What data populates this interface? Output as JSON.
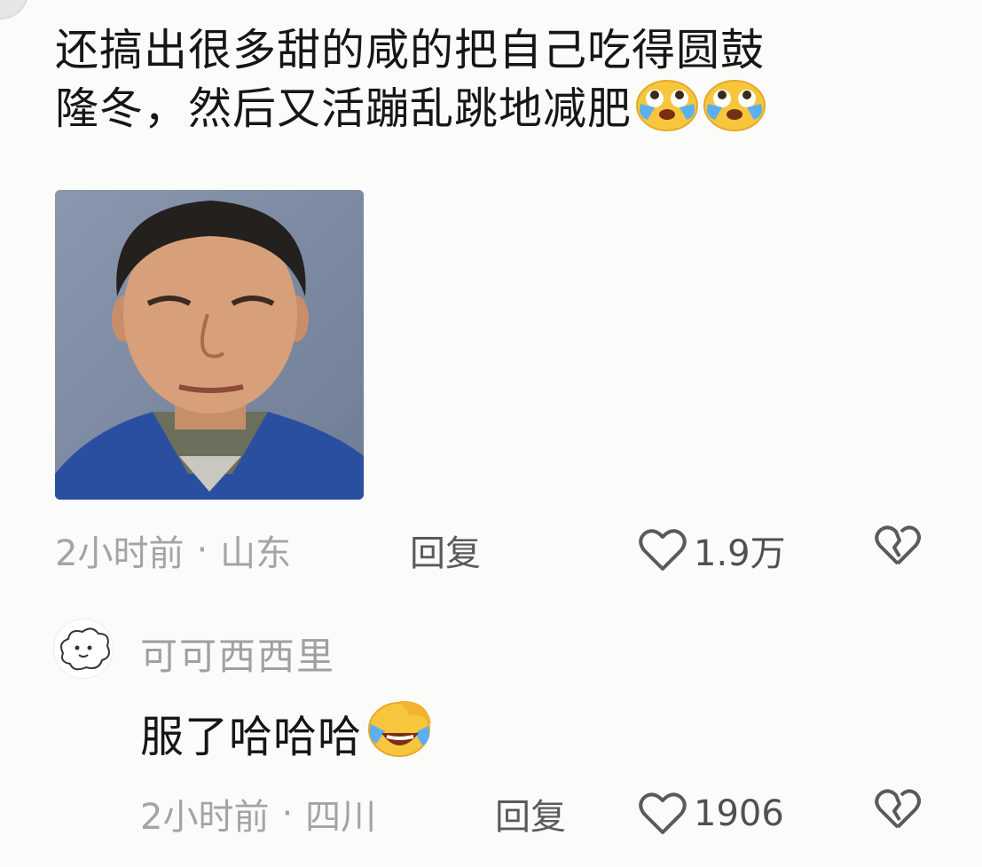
{
  "comment": {
    "text_line1": "还搞出很多甜的咸的把自己吃得圆鼓",
    "text_line2": "隆冬，然后又活蹦乱跳地减肥",
    "emojis": [
      "crying-emoji",
      "crying-emoji"
    ],
    "time": "2小时前",
    "separator": "·",
    "location": "山东",
    "reply_label": "回复",
    "likes": "1.9万"
  },
  "reply": {
    "username": "可可西西里",
    "text": "服了哈哈哈",
    "emoji": "laugh-cry-emoji",
    "time": "2小时前",
    "separator": "·",
    "location": "四川",
    "reply_label": "回复",
    "likes": "1906"
  },
  "colors": {
    "background": "#fbfbfa",
    "meta_text": "#a4a4a4",
    "body_text": "#161616"
  }
}
